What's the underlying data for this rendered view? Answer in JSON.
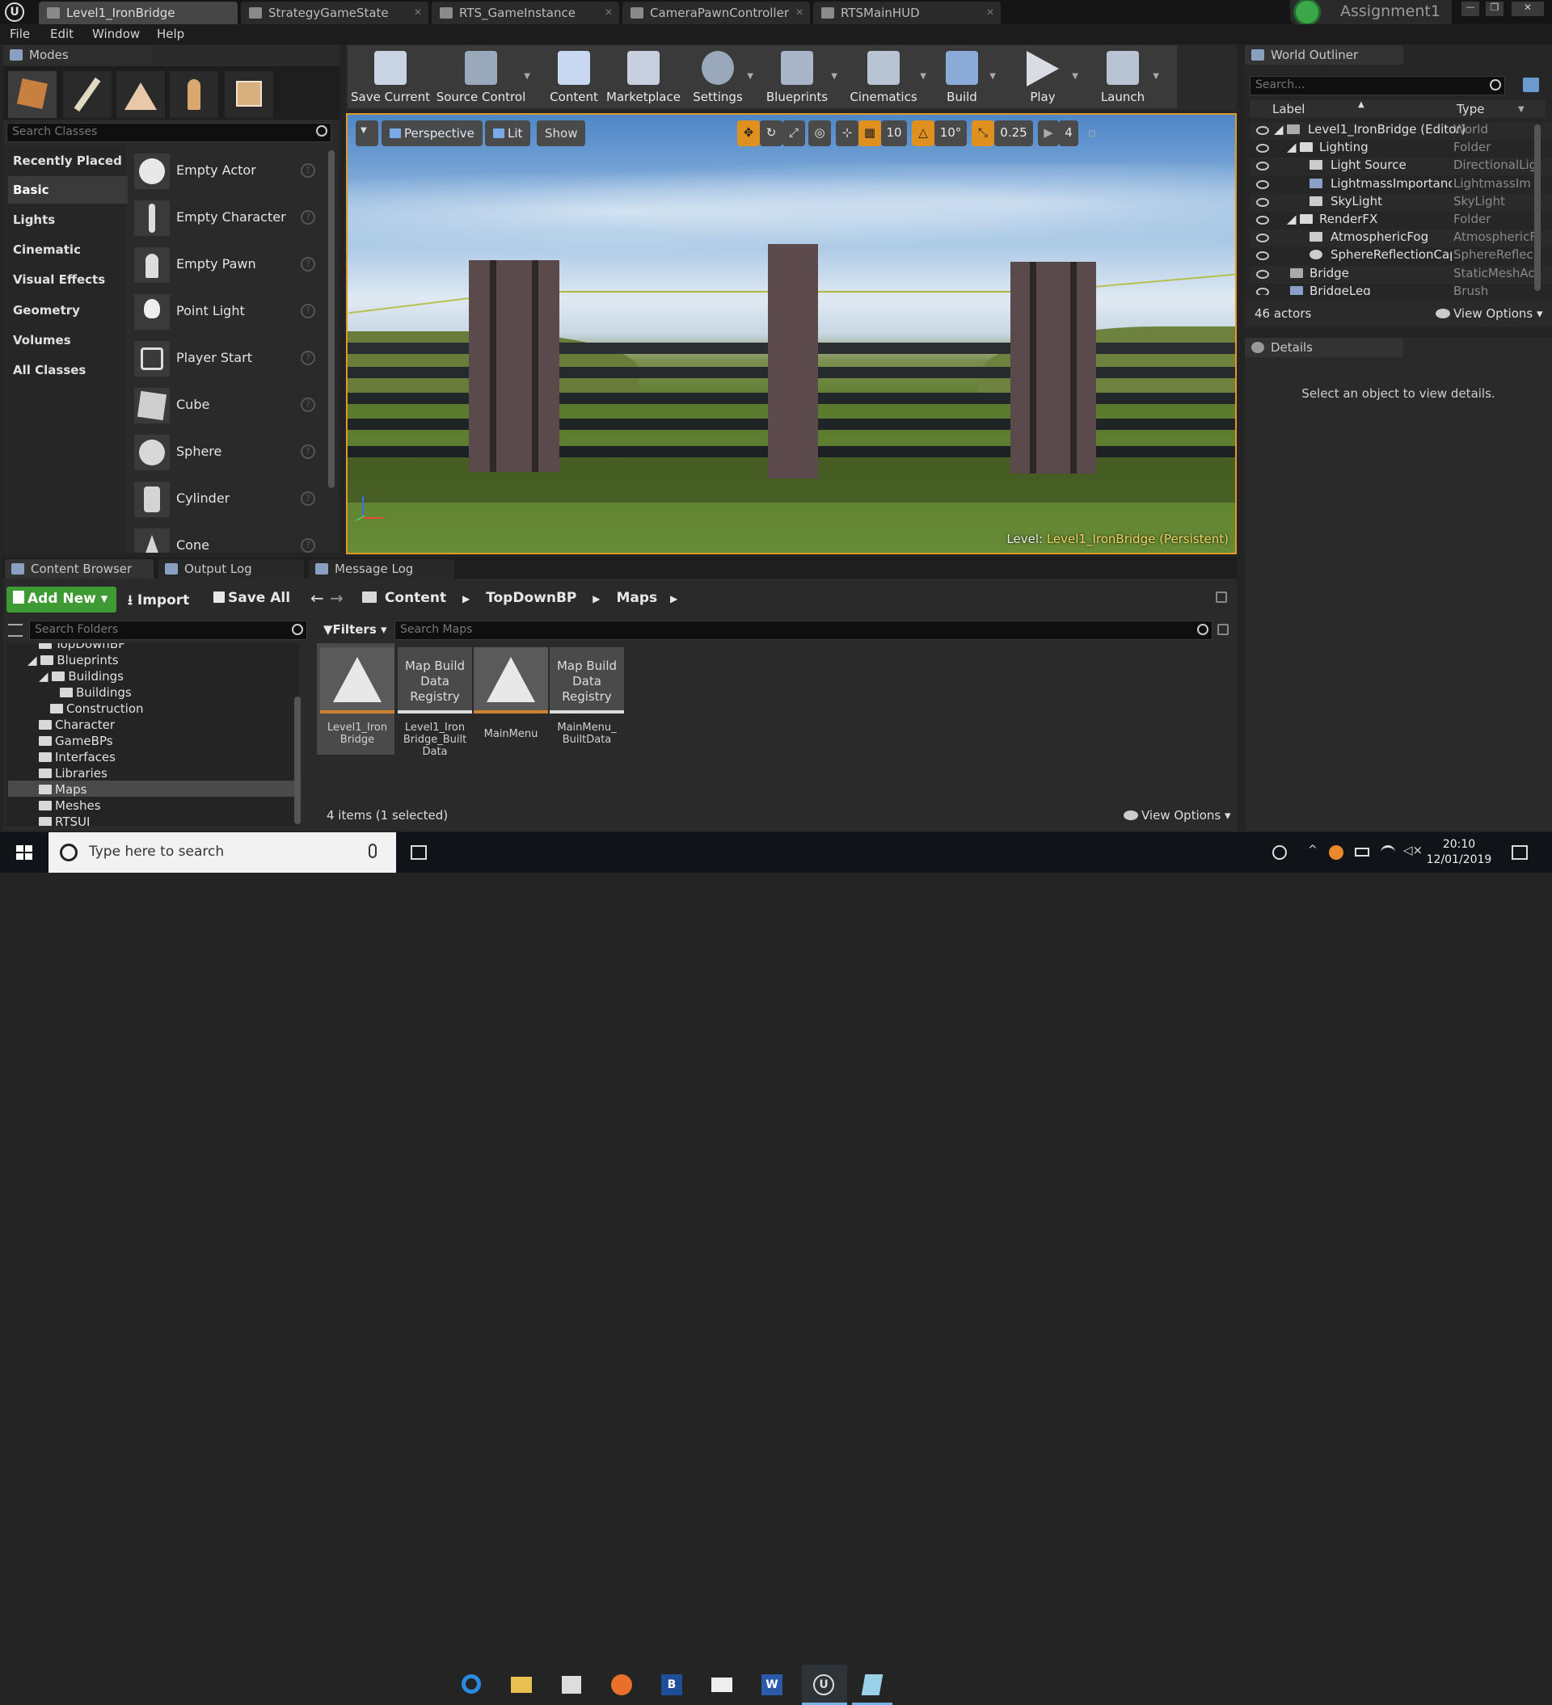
{
  "title_tabs": [
    {
      "label": "Level1_IronBridge",
      "active": true
    },
    {
      "label": "StrategyGameState"
    },
    {
      "label": "RTS_GameInstance"
    },
    {
      "label": "CameraPawnController"
    },
    {
      "label": "RTSMainHUD"
    }
  ],
  "project_name": "Assignment1",
  "window_controls": {
    "minimize": "—",
    "maximize": "❐",
    "close": "✕"
  },
  "menu": [
    "File",
    "Edit",
    "Window",
    "Help"
  ],
  "modes": {
    "header": "Modes",
    "search_placeholder": "Search Classes",
    "categories": [
      "Recently Placed",
      "Basic",
      "Lights",
      "Cinematic",
      "Visual Effects",
      "Geometry",
      "Volumes",
      "All Classes"
    ],
    "selected_category": "Basic",
    "classes": [
      "Empty Actor",
      "Empty Character",
      "Empty Pawn",
      "Point Light",
      "Player Start",
      "Cube",
      "Sphere",
      "Cylinder",
      "Cone"
    ],
    "mode_icons": [
      "place-mode-icon",
      "paint-mode-icon",
      "landscape-mode-icon",
      "foliage-mode-icon",
      "geometry-mode-icon"
    ]
  },
  "toolbar": {
    "buttons": [
      "Save Current",
      "Source Control",
      "Content",
      "Marketplace",
      "Settings",
      "Blueprints",
      "Cinematics",
      "Build",
      "Play",
      "Launch"
    ]
  },
  "viewport": {
    "perspective": "Perspective",
    "lit": "Lit",
    "show": "Show",
    "grid_snap": "10",
    "rotation_snap": "10°",
    "scale_snap": "0.25",
    "camera_speed": "4",
    "level_label": "Level:",
    "level_name": "Level1_IronBridge (Persistent)"
  },
  "outliner": {
    "header": "World Outliner",
    "search_placeholder": "Search...",
    "col_label": "Label",
    "col_type": "Type",
    "rows": [
      {
        "name": "Level1_IronBridge (Editor)",
        "type": "World"
      },
      {
        "name": "Lighting",
        "type": "Folder"
      },
      {
        "name": "Light Source",
        "type": "DirectionalLig"
      },
      {
        "name": "LightmassImportance",
        "type": "LightmassIm"
      },
      {
        "name": "SkyLight",
        "type": "SkyLight"
      },
      {
        "name": "RenderFX",
        "type": "Folder"
      },
      {
        "name": "AtmosphericFog",
        "type": "AtmosphericF"
      },
      {
        "name": "SphereReflectionCapt",
        "type": "SphereReflec"
      },
      {
        "name": "Bridge",
        "type": "StaticMeshAc"
      },
      {
        "name": "BridgeLeg",
        "type": "Brush"
      }
    ],
    "actor_count": "46 actors",
    "view_options": "View Options"
  },
  "details": {
    "header": "Details",
    "empty_message": "Select an object to view details."
  },
  "bottom_tabs": [
    "Content Browser",
    "Output Log",
    "Message Log"
  ],
  "content_browser": {
    "add_new": "Add New",
    "import": "Import",
    "save_all": "Save All",
    "breadcrumb": [
      "Content",
      "TopDownBP",
      "Maps"
    ],
    "search_folders_placeholder": "Search Folders",
    "filters": "Filters",
    "search_maps_placeholder": "Search Maps",
    "folders": [
      {
        "name": "TopDownBP",
        "indent": 1,
        "partial": true
      },
      {
        "name": "Blueprints",
        "indent": 1
      },
      {
        "name": "Buildings",
        "indent": 2
      },
      {
        "name": "Buildings",
        "indent": 3
      },
      {
        "name": "Construction",
        "indent": 2
      },
      {
        "name": "Character",
        "indent": 1
      },
      {
        "name": "GameBPs",
        "indent": 1
      },
      {
        "name": "Interfaces",
        "indent": 1
      },
      {
        "name": "Libraries",
        "indent": 1
      },
      {
        "name": "Maps",
        "indent": 1,
        "selected": true
      },
      {
        "name": "Meshes",
        "indent": 1
      },
      {
        "name": "RTSUI",
        "indent": 1
      }
    ],
    "assets": [
      {
        "thumb": "",
        "name": "Level1_Iron Bridge",
        "kind": "map",
        "selected": true
      },
      {
        "thumb": "Map Build Data Registry",
        "name": "Level1_Iron Bridge_Built Data",
        "kind": "registry"
      },
      {
        "thumb": "",
        "name": "MainMenu",
        "kind": "map"
      },
      {
        "thumb": "Map Build Data Registry",
        "name": "MainMenu_ BuiltData",
        "kind": "registry"
      }
    ],
    "items_status": "4 items (1 selected)",
    "view_options": "View Options"
  },
  "taskbar": {
    "search_placeholder": "Type here to search",
    "time": "20:10",
    "date": "12/01/2019"
  }
}
